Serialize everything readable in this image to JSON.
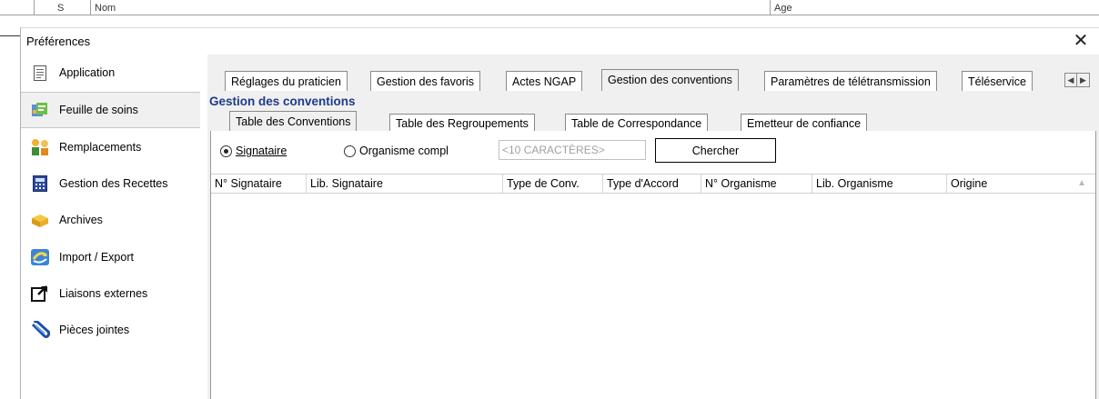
{
  "background": {
    "col_s": "S",
    "col_nom": "Nom",
    "col_age": "Age"
  },
  "dialog": {
    "title": "Préférences",
    "close_label": "✕"
  },
  "sidebar": {
    "items": [
      {
        "label": "Application",
        "icon": "document-icon"
      },
      {
        "label": "Feuille de soins",
        "icon": "care-sheet-icon"
      },
      {
        "label": "Remplacements",
        "icon": "replacement-icon"
      },
      {
        "label": "Gestion des Recettes",
        "icon": "calculator-icon"
      },
      {
        "label": "Archives",
        "icon": "archive-icon"
      },
      {
        "label": "Import / Export",
        "icon": "import-export-icon"
      },
      {
        "label": "Liaisons externes",
        "icon": "external-link-icon"
      },
      {
        "label": "Pièces jointes",
        "icon": "paperclip-icon"
      }
    ]
  },
  "top_tabs": [
    {
      "label": "Réglages du praticien"
    },
    {
      "label": "Gestion des favoris"
    },
    {
      "label": "Actes NGAP"
    },
    {
      "label": "Gestion des conventions"
    },
    {
      "label": "Paramètres de télétransmission"
    },
    {
      "label": "Téléservice"
    }
  ],
  "section_title": "Gestion des conventions",
  "sub_tabs": [
    {
      "label": "Table des Conventions"
    },
    {
      "label": "Table des Regroupements"
    },
    {
      "label": "Table de Correspondance"
    },
    {
      "label": "Emetteur de confiance"
    }
  ],
  "search": {
    "radio_signataire": "Signataire",
    "radio_organisme": "Organisme compl",
    "placeholder": "<10 CARACTÈRES>",
    "button_label": "Chercher"
  },
  "grid": {
    "columns": [
      "N° Signataire",
      "Lib. Signataire",
      "Type de Conv.",
      "Type d'Accord",
      "N° Organisme",
      "Lib. Organisme",
      "Origine"
    ],
    "rows": []
  },
  "colors": {
    "section_title": "#1e3a8a",
    "panel_bg": "#f0f0f0"
  }
}
